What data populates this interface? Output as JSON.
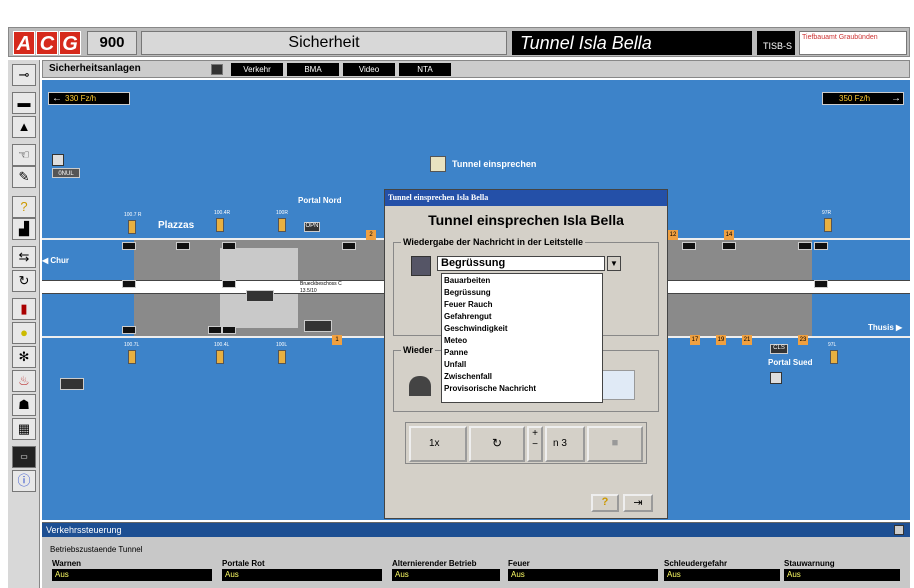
{
  "header": {
    "logo": [
      "A",
      "C",
      "G"
    ],
    "number": "900",
    "section": "Sicherheit",
    "tunnel": "Tunnel Isla Bella",
    "system": "TISB-S",
    "company": "Tiefbauamt Graubünden"
  },
  "toolbar": {
    "title": "Sicherheitsanlagen",
    "tabs": [
      "Verkehr",
      "BMA",
      "Video",
      "NTA"
    ]
  },
  "map": {
    "speed_left": "330 Fz/h",
    "speed_right": "350 Fz/h",
    "tunnel_speak": "Tunnel einsprechen",
    "onul": "0NUL",
    "plazzas": "Plazzas",
    "portal_nord": "Portal Nord",
    "portal_sued": "Portal Sued",
    "chur": "Chur",
    "thusis": "Thusis",
    "opn": "OPN",
    "cls": "CLS",
    "lamps_top": [
      "100.7 R",
      "100.4R",
      "100R",
      "97R"
    ],
    "lamps_bot": [
      "100.7L",
      "100.4L",
      "100L",
      "97L"
    ],
    "segs_top": [
      "2",
      "12",
      "14"
    ],
    "segs_bot": [
      "1",
      "17",
      "19",
      "21",
      "23"
    ],
    "lane_label": "Brueckbeschoss C",
    "lane_sub": "13.5/10"
  },
  "dialog": {
    "title": "Tunnel einsprechen Isla Bella",
    "heading": "Tunnel einsprechen Isla Bella",
    "group1": "Wiedergabe der Nachricht in der Leitstelle",
    "group2": "Wieder",
    "selected": "Begrüssung",
    "options": [
      "Bauarbeiten",
      "Begrüssung",
      "Feuer Rauch",
      "Gefahrengut",
      "Geschwindigkeit",
      "Meteo",
      "Panne",
      "Unfall",
      "Zwischenfall",
      "Provisorische Nachricht"
    ],
    "btn_1x": "1x",
    "btn_n": "n 3",
    "plus": "+",
    "minus": "−",
    "help": "?"
  },
  "bottom": {
    "title": "Verkehrssteuerung",
    "subtitle": "Betriebszustaende Tunnel",
    "labels": [
      "Warnen",
      "Portale Rot",
      "Alternierender Betrieb",
      "Feuer",
      "Schleudergefahr",
      "Stauwarnung"
    ],
    "values": [
      "Aus",
      "Aus",
      "Aus",
      "Aus",
      "Aus",
      "Aus"
    ]
  },
  "colors": {
    "accent": "#d62a1c",
    "map_bg": "#3d83c9",
    "title_bar": "#2450a8"
  }
}
